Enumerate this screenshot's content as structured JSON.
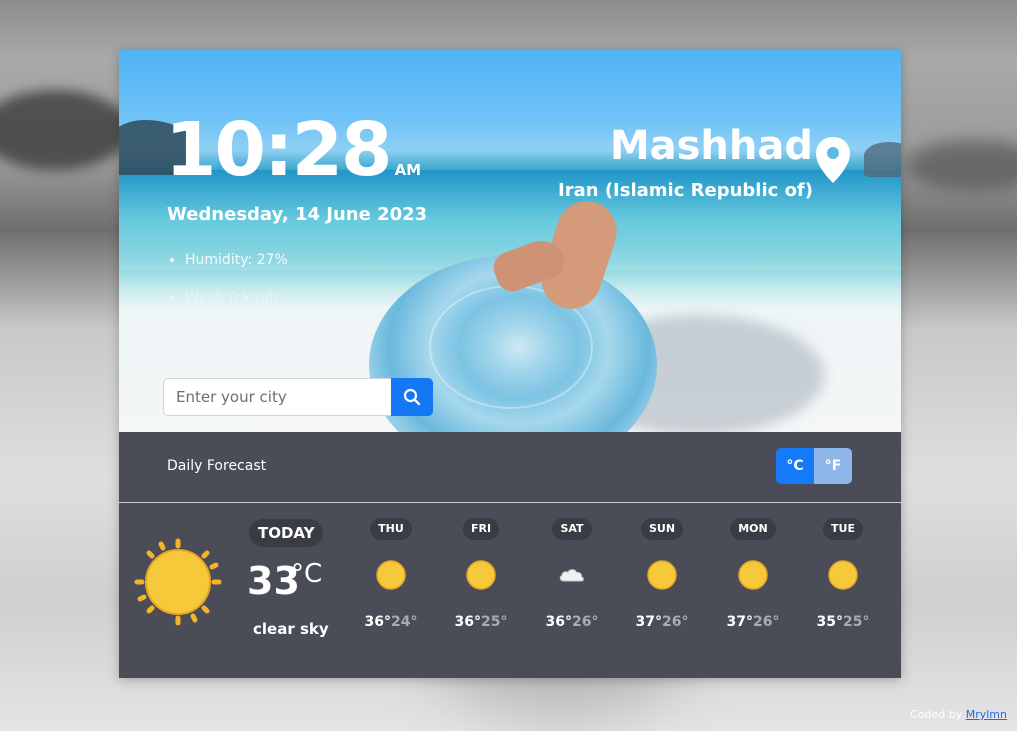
{
  "clock": {
    "time": "10:28",
    "ampm": "AM",
    "date": "Wednesday, 14 June 2023"
  },
  "details": [
    {
      "label": "Humidity: 27%"
    },
    {
      "label": "Wind: 0 km/h"
    }
  ],
  "location": {
    "city": "Mashhad",
    "country": "Iran (Islamic Republic of)"
  },
  "search": {
    "placeholder": "Enter your city"
  },
  "forecast_header": {
    "title": "Daily Forecast",
    "unit_c": "°C",
    "unit_f": "°F"
  },
  "today": {
    "badge": "TODAY",
    "temp": "33",
    "unit": "°C",
    "description": "clear sky",
    "icon": "sun-icon"
  },
  "days": [
    {
      "name": "THU",
      "icon": "sun-icon",
      "high": "36°",
      "low": "24°"
    },
    {
      "name": "FRI",
      "icon": "sun-icon",
      "high": "36°",
      "low": "25°"
    },
    {
      "name": "SAT",
      "icon": "cloud-icon",
      "high": "36°",
      "low": "26°"
    },
    {
      "name": "SUN",
      "icon": "sun-icon",
      "high": "37°",
      "low": "26°"
    },
    {
      "name": "MON",
      "icon": "sun-icon",
      "high": "37°",
      "low": "26°"
    },
    {
      "name": "TUE",
      "icon": "sun-icon",
      "high": "35°",
      "low": "25°"
    }
  ],
  "footer": {
    "prefix": "Coded by ",
    "author": "Mrylmn"
  },
  "colors": {
    "accent": "#1679f7",
    "panel": "#4a4d57",
    "badge": "#3a3c43"
  }
}
